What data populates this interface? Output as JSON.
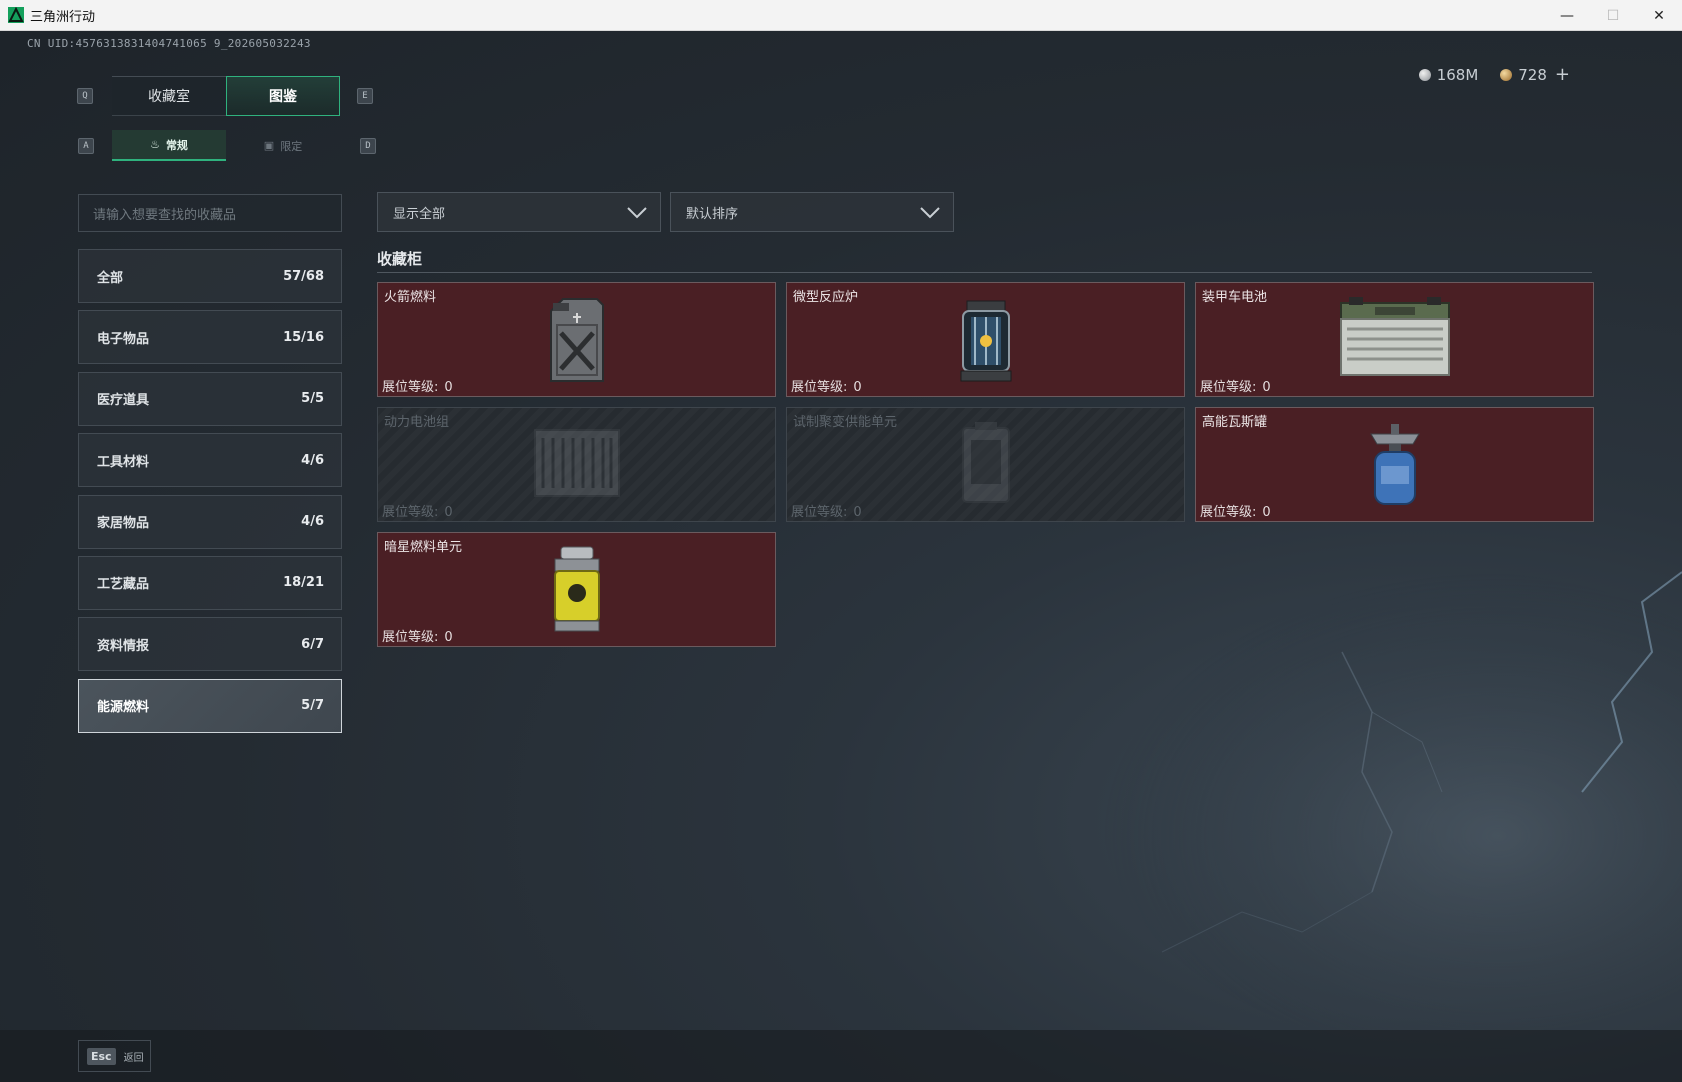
{
  "window": {
    "title": "三角洲行动",
    "controls": [
      "—",
      "☐",
      "✕"
    ]
  },
  "uid": "CN UID:4576313831404741065 9_202605032243",
  "currency": {
    "silver": "168M",
    "gold": "728",
    "plus": "+"
  },
  "keyhints": {
    "prev_tab": "Q",
    "next_tab": "E",
    "prev_sub": "A",
    "next_sub": "D"
  },
  "main_tabs": [
    {
      "label": "收藏室",
      "active": false
    },
    {
      "label": "图鉴",
      "active": true
    }
  ],
  "sub_tabs": [
    {
      "label": "常规",
      "icon": "flame-icon",
      "active": true
    },
    {
      "label": "限定",
      "icon": "image-icon",
      "active": false
    }
  ],
  "search": {
    "placeholder": "请输入想要查找的收藏品"
  },
  "filters": {
    "show": "显示全部",
    "sort": "默认排序"
  },
  "categories": [
    {
      "label": "全部",
      "count": "57/68"
    },
    {
      "label": "电子物品",
      "count": "15/16"
    },
    {
      "label": "医疗道具",
      "count": "5/5"
    },
    {
      "label": "工具材料",
      "count": "4/6"
    },
    {
      "label": "家居物品",
      "count": "4/6"
    },
    {
      "label": "工艺藏品",
      "count": "18/21"
    },
    {
      "label": "资料情报",
      "count": "6/7"
    },
    {
      "label": "能源燃料",
      "count": "5/7",
      "active": true
    }
  ],
  "section_title": "收藏柜",
  "level_label": "展位等级:",
  "items": [
    {
      "name": "火箭燃料",
      "level": "0",
      "locked": false,
      "icon": "fuel-can-icon"
    },
    {
      "name": "微型反应炉",
      "level": "0",
      "locked": false,
      "icon": "reactor-icon"
    },
    {
      "name": "装甲车电池",
      "level": "0",
      "locked": false,
      "icon": "battery-icon"
    },
    {
      "name": "动力电池组",
      "level": "0",
      "locked": true,
      "icon": "battery-pack-icon"
    },
    {
      "name": "试制聚变供能单元",
      "level": "0",
      "locked": true,
      "icon": "fusion-unit-icon"
    },
    {
      "name": "高能瓦斯罐",
      "level": "0",
      "locked": false,
      "icon": "gas-canister-icon"
    },
    {
      "name": "暗星燃料单元",
      "level": "0",
      "locked": false,
      "icon": "fuel-cell-icon"
    }
  ],
  "bottom": {
    "esc_key": "Esc",
    "esc_label": "返回"
  },
  "colors": {
    "accent": "#2fb27e",
    "card_unlocked": "#4a1f24",
    "background": "#242b32"
  }
}
